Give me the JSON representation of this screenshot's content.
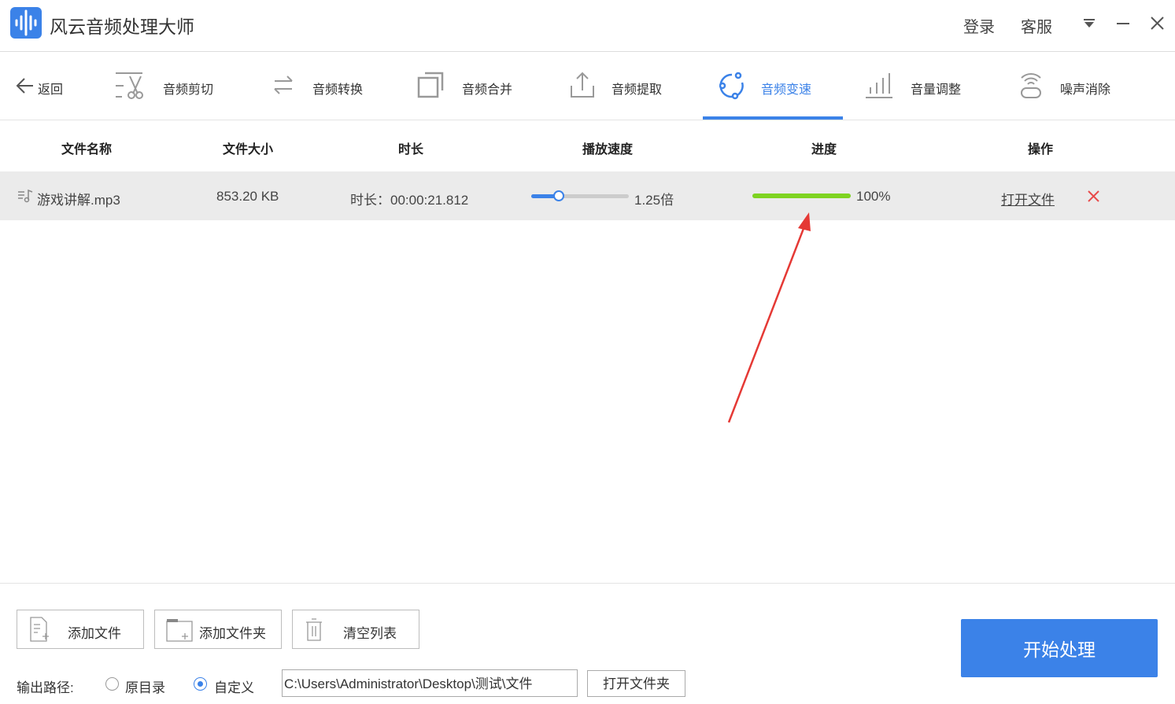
{
  "app": {
    "title": "风云音频处理大师",
    "login": "登录",
    "service": "客服"
  },
  "toolbar": {
    "back": "返回",
    "items": [
      {
        "label": "音频剪切",
        "icon": "scissors-icon"
      },
      {
        "label": "音频转换",
        "icon": "convert-icon"
      },
      {
        "label": "音频合并",
        "icon": "merge-icon"
      },
      {
        "label": "音频提取",
        "icon": "extract-icon"
      },
      {
        "label": "音频变速",
        "icon": "speed-icon",
        "active": true
      },
      {
        "label": "音量调整",
        "icon": "volume-icon"
      },
      {
        "label": "噪声消除",
        "icon": "noise-icon"
      }
    ]
  },
  "table": {
    "headers": [
      "文件名称",
      "文件大小",
      "时长",
      "播放速度",
      "进度",
      "操作"
    ],
    "rows": [
      {
        "name": "游戏讲解.mp3",
        "size": "853.20 KB",
        "duration": "时长：00:00:21.812",
        "speed_label": "1.25倍",
        "speed_fraction": 0.28,
        "progress": 100,
        "progress_label": "100%",
        "action": "打开文件"
      }
    ]
  },
  "bottom": {
    "add_file": "添加文件",
    "add_folder": "添加文件夹",
    "clear": "清空列表",
    "output_label": "输出路径:",
    "opt_original": "原目录",
    "opt_custom": "自定义",
    "path": "C:\\Users\\Administrator\\Desktop\\测试\\文件",
    "open_folder": "打开文件夹",
    "start": "开始处理"
  },
  "colors": {
    "accent": "#3b82e8",
    "progress": "#7ed321",
    "delete": "#e84a4a",
    "annotation": "#e53935"
  }
}
